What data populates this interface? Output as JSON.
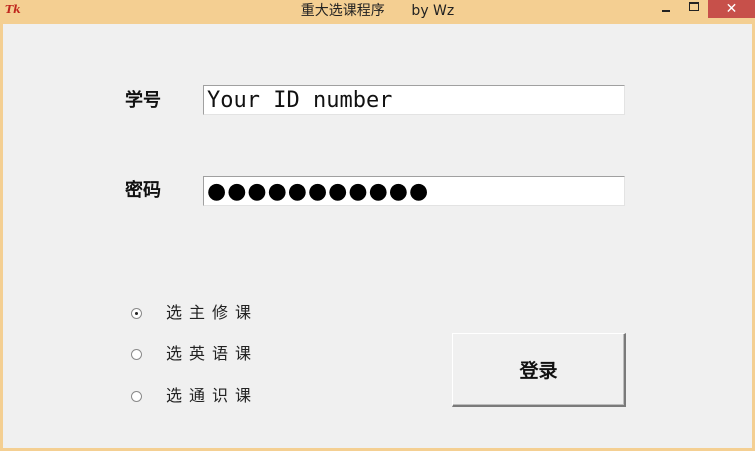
{
  "window": {
    "title": "重大选课程序      by Wz",
    "icon_text": "Tk"
  },
  "form": {
    "id_label": "学号",
    "id_value": "Your ID number",
    "password_label": "密码",
    "password_dots": "●●●●●●●●●●●"
  },
  "options": [
    {
      "label": "选主修课",
      "checked": true
    },
    {
      "label": "选英语课",
      "checked": false
    },
    {
      "label": "选通识课",
      "checked": false
    }
  ],
  "actions": {
    "login_label": "登录"
  },
  "colors": {
    "titlebar": "#f4cf92",
    "close_button": "#c7504a",
    "client_bg": "#f0f0f0"
  }
}
